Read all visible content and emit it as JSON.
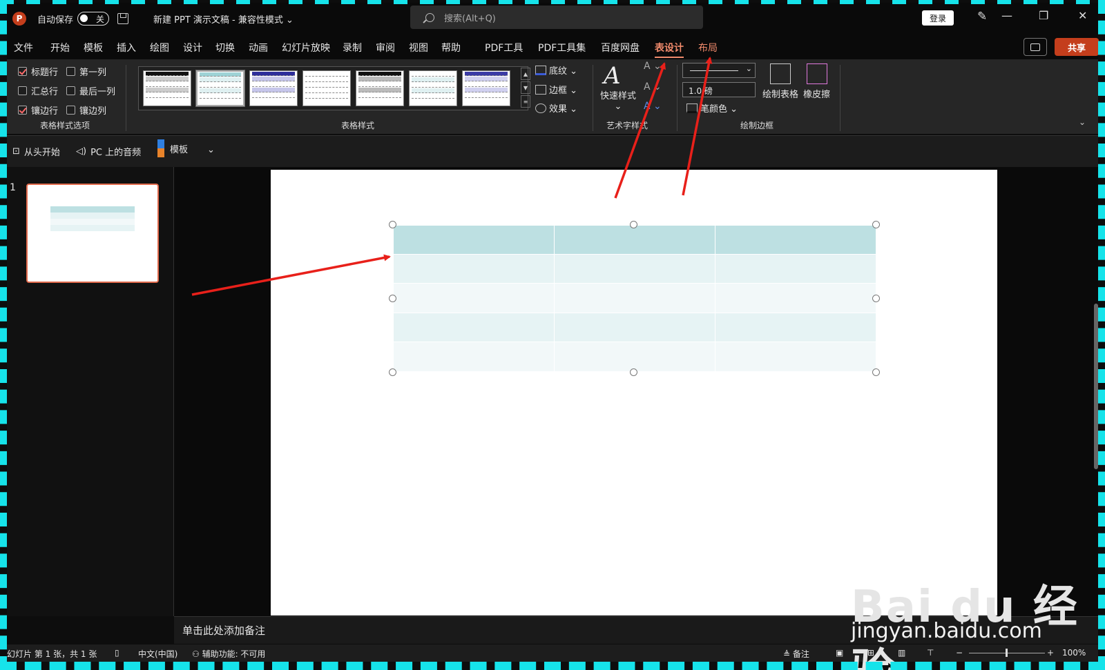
{
  "titlebar": {
    "logo": "P",
    "autosave_label": "自动保存",
    "toggle_state": "关",
    "doc_title": "新建 PPT 演示文稿  -  兼容性模式  ⌄",
    "search_placeholder": "搜索(Alt+Q)",
    "login_label": "登录",
    "minimize": "—",
    "restore": "❐",
    "close": "✕"
  },
  "menu": {
    "tabs": [
      "文件",
      "开始",
      "模板",
      "插入",
      "绘图",
      "设计",
      "切换",
      "动画",
      "幻灯片放映",
      "录制",
      "审阅",
      "视图",
      "帮助",
      "PDF工具",
      "PDF工具集",
      "百度网盘",
      "表设计",
      "布局"
    ],
    "active_tab": "表设计",
    "share_label": "共享"
  },
  "ribbon": {
    "style_options": {
      "header_row": {
        "label": "标题行",
        "checked": true
      },
      "first_column": {
        "label": "第一列",
        "checked": false
      },
      "total_row": {
        "label": "汇总行",
        "checked": false
      },
      "last_column": {
        "label": "最后一列",
        "checked": false
      },
      "banded_rows": {
        "label": "镶边行",
        "checked": true
      },
      "banded_columns": {
        "label": "镶边列",
        "checked": false
      },
      "group_label": "表格样式选项"
    },
    "table_styles": {
      "group_label": "表格样式",
      "shading": "底纹 ⌄",
      "borders": "边框  ⌄",
      "effects": "效果 ⌄"
    },
    "wordart": {
      "quick_styles": "快速样式",
      "quick_styles_arrow": "⌄",
      "group_label": "艺术字样式"
    },
    "draw_borders": {
      "weight": "1.0 磅",
      "pen_color": "笔颜色 ⌄",
      "draw_table": "绘制表格",
      "eraser": "橡皮擦",
      "group_label": "绘制边框"
    }
  },
  "quick_access": {
    "from_start": "从头开始",
    "pc_audio": "PC 上的音频",
    "template": "模板",
    "more": "⌄"
  },
  "slides_pane": {
    "slide_number": "1"
  },
  "notes": {
    "placeholder": "单击此处添加备注"
  },
  "status": {
    "slide_info": "幻灯片 第 1 张，共 1 张",
    "language": "中文(中国)",
    "accessibility": "辅助功能: 不可用",
    "notes": "备注",
    "zoom": "100%",
    "minus": "−",
    "plus": "+"
  },
  "watermark": {
    "brand": "Bai du 经验",
    "url": "jingyan.baidu.com"
  },
  "colors": {
    "accent": "#f08a6c",
    "share": "#c43e1c",
    "arrow": "#e8201a",
    "frame": "#16e3ea",
    "table_header": "#bde0e2",
    "table_band": "#e6f3f4"
  }
}
